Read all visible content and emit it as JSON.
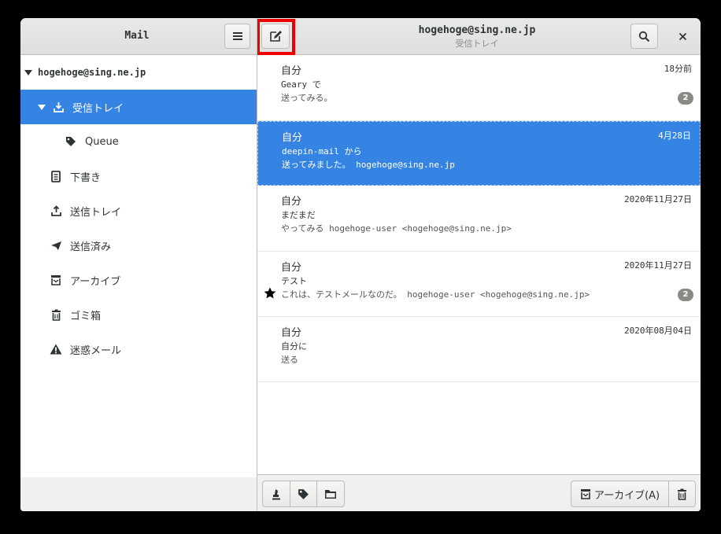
{
  "app": {
    "title": "Mail"
  },
  "conversation_header": {
    "account": "hogehoge@sing.ne.jp",
    "folder": "受信トレイ"
  },
  "sidebar": {
    "account": "hogehoge@sing.ne.jp",
    "folders": [
      {
        "label": "受信トレイ",
        "icon": "inbox-icon",
        "selected": true
      },
      {
        "label": "Queue",
        "icon": "tag-icon"
      },
      {
        "label": "下書き",
        "icon": "drafts-icon"
      },
      {
        "label": "送信トレイ",
        "icon": "outbox-icon"
      },
      {
        "label": "送信済み",
        "icon": "sent-icon"
      },
      {
        "label": "アーカイブ",
        "icon": "archive-icon"
      },
      {
        "label": "ゴミ箱",
        "icon": "trash-icon"
      },
      {
        "label": "迷惑メール",
        "icon": "junk-icon"
      }
    ]
  },
  "messages": [
    {
      "from": "自分",
      "date": "18分前",
      "subject": "Geary で",
      "preview": "送ってみる。",
      "count": "2",
      "starred": false,
      "selected": false
    },
    {
      "from": "自分",
      "date": "4月28日",
      "subject": "deepin-mail から",
      "preview": "送ってみました。 hogehoge@sing.ne.jp",
      "count": "",
      "starred": false,
      "selected": true
    },
    {
      "from": "自分",
      "date": "2020年11月27日",
      "subject": "まだまだ",
      "preview": "やってみる hogehoge-user <hogehoge@sing.ne.jp>",
      "count": "",
      "starred": false,
      "selected": false
    },
    {
      "from": "自分",
      "date": "2020年11月27日",
      "subject": "テスト",
      "preview": "これは、テストメールなのだ。 hogehoge-user <hogehoge@sing.ne.jp>",
      "count": "2",
      "starred": true,
      "selected": false
    },
    {
      "from": "自分",
      "date": "2020年08月04日",
      "subject": "自分に",
      "preview": "送る",
      "count": "",
      "starred": false,
      "selected": false
    }
  ],
  "footer": {
    "archive_label": "アーカイブ(A)"
  },
  "colors": {
    "accent": "#3584e4",
    "highlight": "#ee0000",
    "badge": "#888a85"
  }
}
